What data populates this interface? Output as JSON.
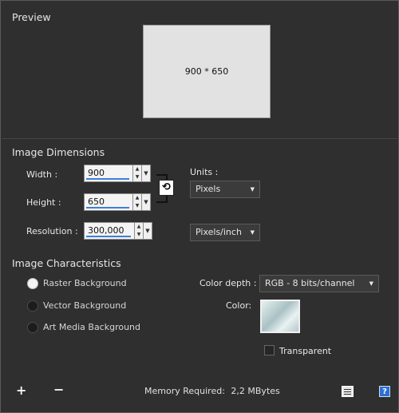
{
  "preview": {
    "title": "Preview",
    "size_label": "900 * 650"
  },
  "dimensions": {
    "title": "Image Dimensions",
    "width_label": "Width :",
    "width_value": "900",
    "height_label": "Height :",
    "height_value": "650",
    "resolution_label": "Resolution :",
    "resolution_value": "300,000",
    "units_label": "Units :",
    "units_value": "Pixels",
    "resolution_units_value": "Pixels/inch",
    "link_icon": "link-icon"
  },
  "characteristics": {
    "title": "Image Characteristics",
    "backgrounds": [
      {
        "label": "Raster Background",
        "selected": true
      },
      {
        "label": "Vector Background",
        "selected": false
      },
      {
        "label": "Art Media Background",
        "selected": false
      }
    ],
    "color_depth_label": "Color depth :",
    "color_depth_value": "RGB - 8 bits/channel",
    "color_label": "Color:",
    "transparent_label": "Transparent",
    "transparent_checked": false
  },
  "footer": {
    "add_icon": "plus-icon",
    "remove_icon": "minus-icon",
    "memory_label": "Memory Required:",
    "memory_value": "2,2 MBytes",
    "presets_icon": "presets-icon",
    "help_icon": "help-icon"
  },
  "colors": {
    "panel_bg": "#2f2f2f",
    "accent": "#3d7fd8"
  }
}
